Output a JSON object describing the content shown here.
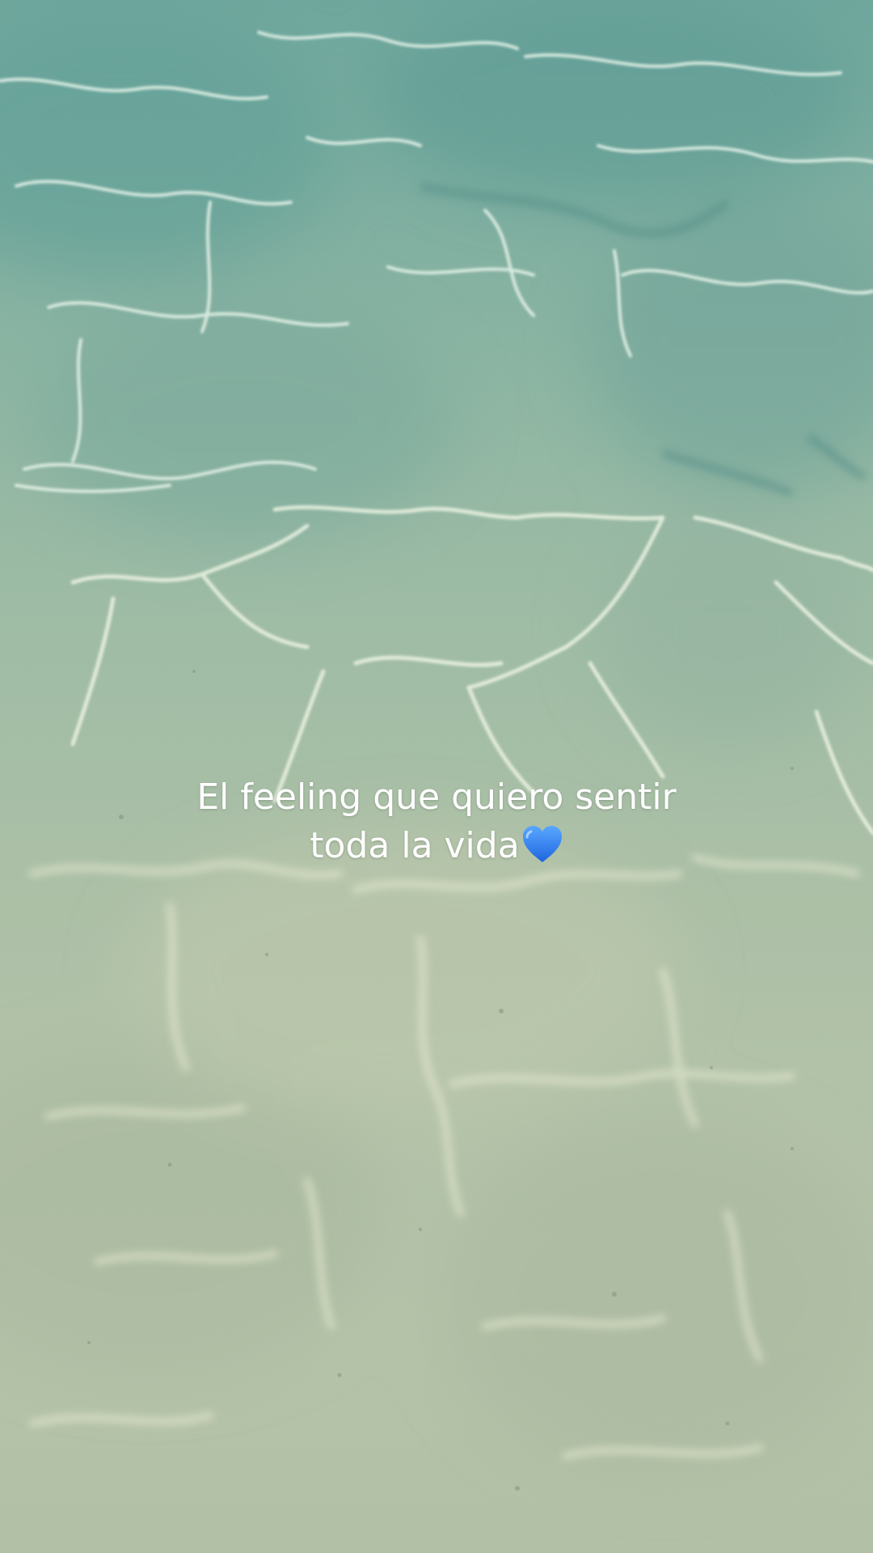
{
  "caption": {
    "line1": "El feeling que quiero sentir",
    "line2": "toda la vida"
  },
  "icons": {
    "heart": "blue-heart-icon"
  },
  "colors": {
    "caption_text": "#ffffff",
    "heart": "#2f7ff2",
    "water_top": "#6fa79d",
    "sand_bottom": "#b2c0a6"
  }
}
